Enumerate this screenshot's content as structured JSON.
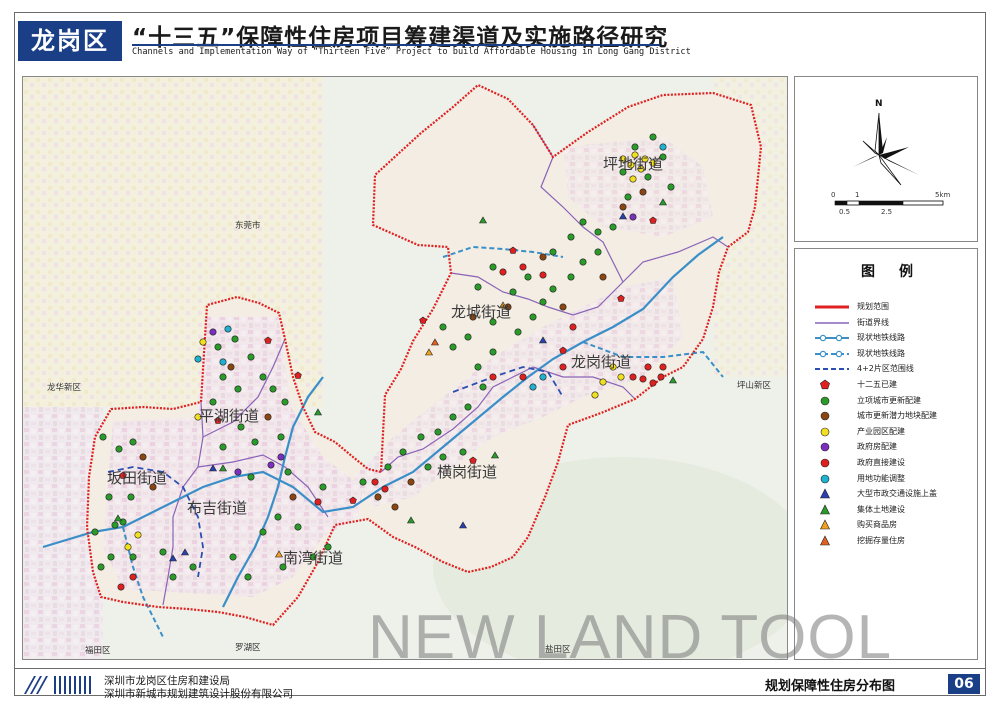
{
  "header": {
    "badge": "龙岗区",
    "title_cn": "“十三五”保障性住房项目筹建渠道及实施路径研究",
    "title_en": "Channels and Implementation Way of “Thirteen Five” Project to build Affordable Housing in Long Gang District"
  },
  "map": {
    "streets": [
      {
        "key": "pingdi",
        "name": "坪地街道"
      },
      {
        "key": "longcheng",
        "name": "龙城街道"
      },
      {
        "key": "longgang",
        "name": "龙岗街道"
      },
      {
        "key": "pinghu",
        "name": "平湖街道"
      },
      {
        "key": "bantian",
        "name": "坂田街道"
      },
      {
        "key": "buji",
        "name": "布吉街道"
      },
      {
        "key": "henggang",
        "name": "横岗街道"
      },
      {
        "key": "nanwan",
        "name": "南湾街道"
      }
    ],
    "places": {
      "dongguan": "东莞市",
      "longhua": "龙华新区",
      "pingshan": "坪山新区",
      "futian": "福田区",
      "luohu": "罗湖区",
      "yantian": "盐田区"
    }
  },
  "compass": {
    "north": "N"
  },
  "scale": {
    "ticks_top": [
      "0",
      "1",
      "5km"
    ],
    "ticks_bottom": [
      "0.5",
      "2.5"
    ]
  },
  "legend": {
    "title": "图例",
    "items": [
      {
        "label": "规划范围",
        "symbol": "line",
        "color": "#e02020",
        "style": "solid",
        "width": 3
      },
      {
        "label": "街道界线",
        "symbol": "line",
        "color": "#8a63b8",
        "style": "solid",
        "width": 1.5
      },
      {
        "label": "现状地铁线路",
        "symbol": "metro",
        "color": "#3a8fc8",
        "style": "solid",
        "width": 2
      },
      {
        "label": "现状地铁线路",
        "symbol": "metro",
        "color": "#3a8fc8",
        "style": "dashed",
        "width": 2
      },
      {
        "label": "4+2片区范围线",
        "symbol": "line",
        "color": "#2a4fb0",
        "style": "dashed",
        "width": 2
      },
      {
        "label": "十二五已建",
        "symbol": "pentagon",
        "color": "#e02020"
      },
      {
        "label": "立项城市更新配建",
        "symbol": "circle",
        "color": "#2a9a2a"
      },
      {
        "label": "城市更新潜力地块配建",
        "symbol": "circle",
        "color": "#8b4513"
      },
      {
        "label": "产业园区配建",
        "symbol": "circle",
        "color": "#f2e020"
      },
      {
        "label": "政府房配建",
        "symbol": "circle",
        "color": "#7b2fbf"
      },
      {
        "label": "政府直接建设",
        "symbol": "circle",
        "color": "#e02020"
      },
      {
        "label": "用地功能调整",
        "symbol": "circle",
        "color": "#20b0d0"
      },
      {
        "label": "大型市政交通设施上盖",
        "symbol": "triangle",
        "color": "#2a3fb0"
      },
      {
        "label": "集体土地建设",
        "symbol": "triangle",
        "color": "#2a9a2a"
      },
      {
        "label": "购买商品房",
        "symbol": "triangle",
        "color": "#f2a020"
      },
      {
        "label": "挖掘存量住房",
        "symbol": "triangle",
        "color": "#e06020"
      }
    ]
  },
  "footer": {
    "org1": "深圳市龙岗区住房和建设局",
    "org2": "深圳市新城市规划建筑设计股份有限公司",
    "fig_title": "规划保障性住房分布图",
    "fig_num": "06"
  },
  "watermark": "NEW LAND TOOL",
  "colors": {
    "accent": "#1a3f86",
    "boundary": "#e02020",
    "map_bg": "#eef1ea"
  }
}
